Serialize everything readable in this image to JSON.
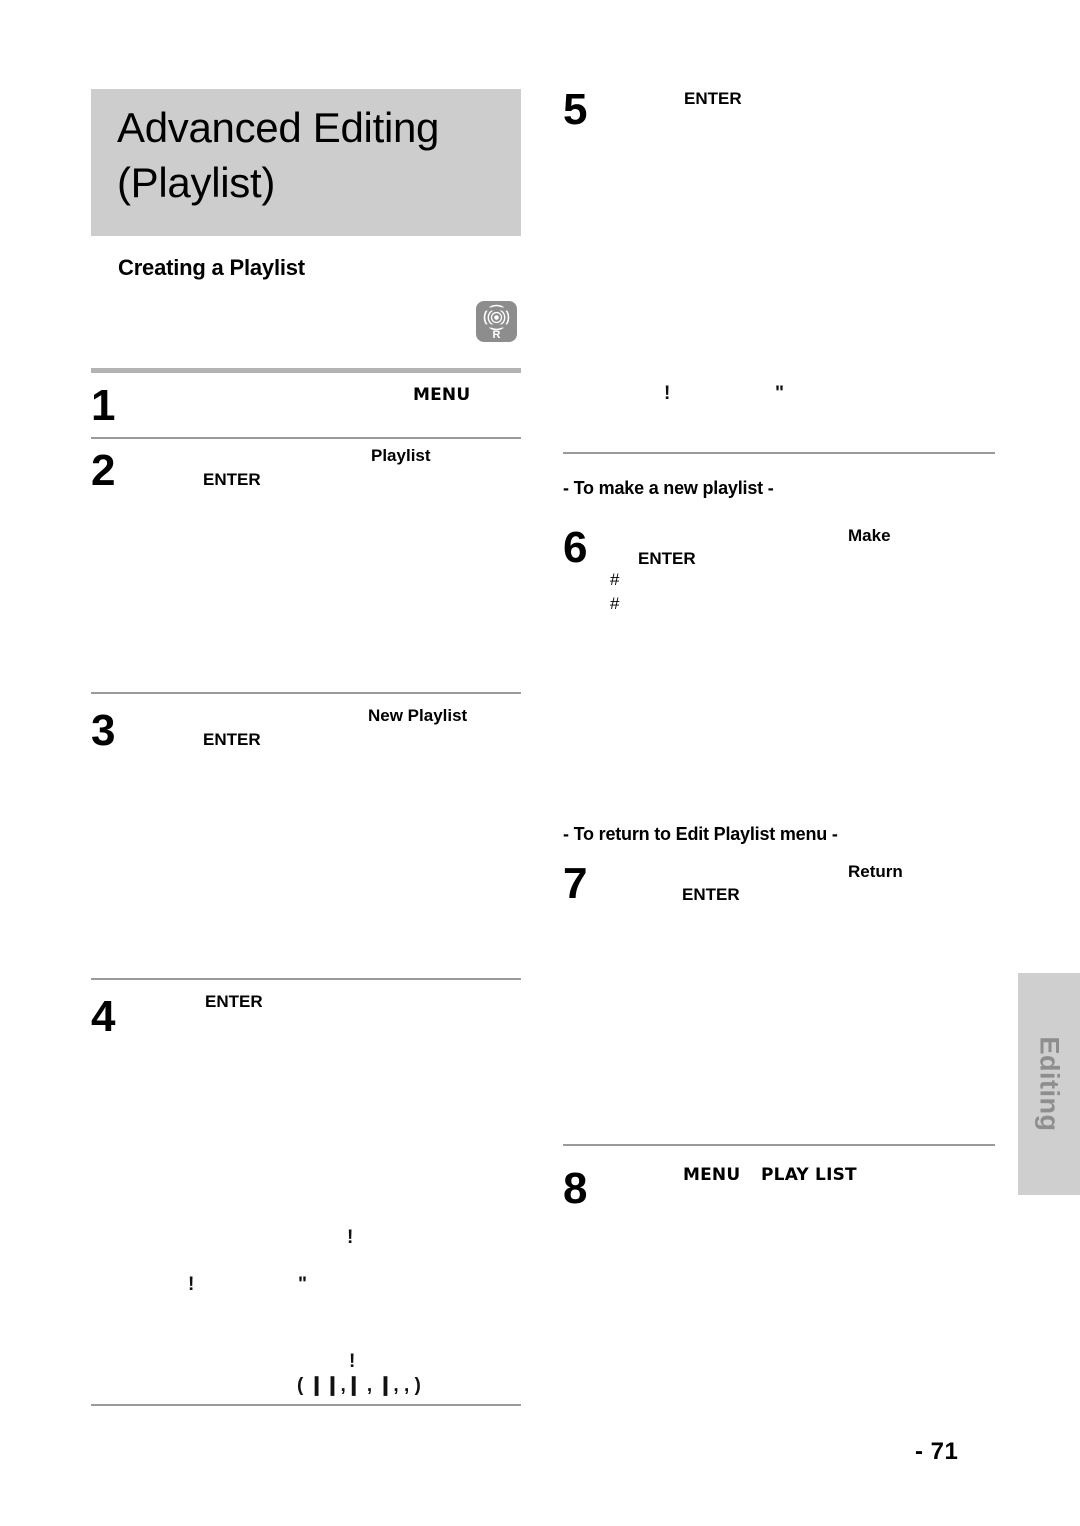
{
  "page": {
    "number_label": "- 71",
    "side_tab_label": "Editing"
  },
  "header": {
    "title_line1": "Advanced Editing",
    "title_line2": "(Playlist)",
    "section_heading": "Creating a Playlist"
  },
  "badge": {
    "media_label": "R",
    "icon": "disc-icon"
  },
  "left_column": {
    "steps": [
      {
        "number": "1",
        "keywords": [
          {
            "text": "MENU",
            "style": "wide"
          }
        ]
      },
      {
        "number": "2",
        "keywords": [
          {
            "text": "Playlist",
            "style": "normal"
          },
          {
            "text": "ENTER",
            "style": "normal"
          }
        ]
      },
      {
        "number": "3",
        "keywords": [
          {
            "text": "New Playlist",
            "style": "normal"
          },
          {
            "text": "ENTER",
            "style": "normal"
          }
        ]
      },
      {
        "number": "4",
        "keywords": [
          {
            "text": "ENTER",
            "style": "normal"
          }
        ]
      }
    ],
    "note_fragments": [
      "!",
      "!",
      "\"",
      "!"
    ],
    "control_fragment": "(  ❙❙,❙     ,      ❙,    ,     )"
  },
  "right_column": {
    "steps": [
      {
        "number": "5",
        "keywords": [
          {
            "text": "ENTER",
            "style": "normal"
          }
        ]
      },
      {
        "number": "6",
        "keywords": [
          {
            "text": "Make",
            "style": "normal"
          },
          {
            "text": "ENTER",
            "style": "normal"
          }
        ],
        "bullets": [
          "#",
          "#"
        ]
      },
      {
        "number": "7",
        "keywords": [
          {
            "text": "Return",
            "style": "normal"
          },
          {
            "text": "ENTER",
            "style": "normal"
          }
        ]
      },
      {
        "number": "8",
        "keywords": [
          {
            "text": "MENU",
            "style": "wide"
          },
          {
            "text": "PLAY LIST",
            "style": "wide"
          }
        ]
      }
    ],
    "subheadings": [
      "- To make a new playlist -",
      "- To return to Edit Playlist menu -"
    ],
    "note_fragments": [
      "!",
      "\""
    ]
  }
}
